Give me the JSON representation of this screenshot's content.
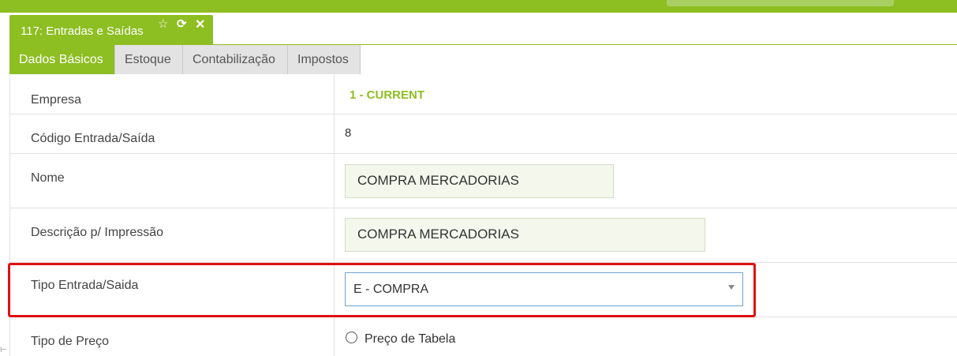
{
  "window": {
    "title": "117: Entradas e Saídas",
    "icons": {
      "star": "star-icon",
      "refresh": "refresh-icon",
      "close": "close-icon"
    }
  },
  "tabs": [
    {
      "label": "Dados Básicos",
      "active": true
    },
    {
      "label": "Estoque",
      "active": false
    },
    {
      "label": "Contabilização",
      "active": false
    },
    {
      "label": "Impostos",
      "active": false
    }
  ],
  "form": {
    "empresa": {
      "label": "Empresa",
      "value": "1 - CURRENT"
    },
    "codigo": {
      "label": "Código Entrada/Saída",
      "value": "8"
    },
    "nome": {
      "label": "Nome",
      "value": "COMPRA MERCADORIAS"
    },
    "descricao": {
      "label": "Descrição p/ Impressão",
      "value": "COMPRA MERCADORIAS"
    },
    "tipo": {
      "label": "Tipo Entrada/Saida",
      "value": "E - COMPRA"
    },
    "preco": {
      "label": "Tipo de Preço",
      "option": "Preço de Tabela",
      "selected": false
    }
  },
  "colors": {
    "accent": "#8dbe22",
    "highlight": "#e01010"
  }
}
